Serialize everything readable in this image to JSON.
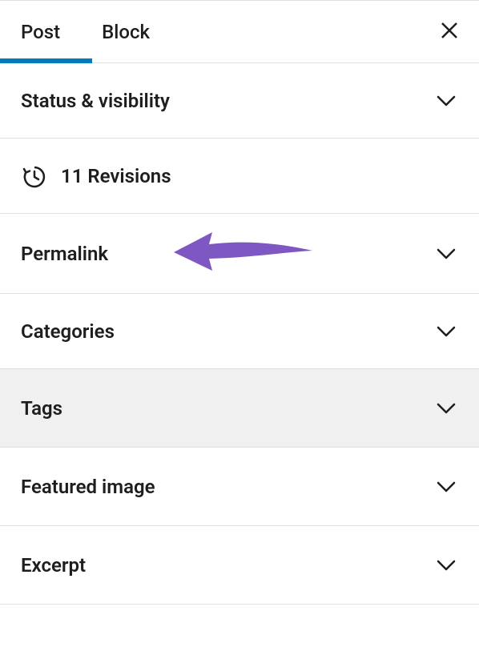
{
  "tabs": {
    "post": "Post",
    "block": "Block"
  },
  "panels": {
    "status": "Status & visibility",
    "revisions": "11 Revisions",
    "permalink": "Permalink",
    "categories": "Categories",
    "tags": "Tags",
    "featured_image": "Featured image",
    "excerpt": "Excerpt"
  }
}
